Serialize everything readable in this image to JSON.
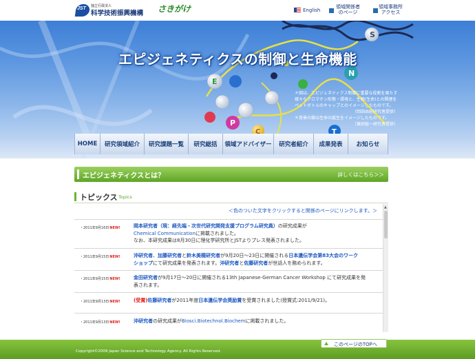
{
  "header": {
    "jst_small": "独立行政法人",
    "jst_name": "科学技術振興機構",
    "jst_mark": "JST",
    "sakigake": "さきがけ",
    "english": "English",
    "area_page": [
      "領域関係者",
      "のページ"
    ],
    "area_access": [
      "領域事務所",
      "アクセス"
    ]
  },
  "hero": {
    "title": "エピジェネティクスの制御と生命機能",
    "letters": [
      "S",
      "E",
      "N",
      "P",
      "C",
      "T"
    ],
    "caption": [
      "＊図は、エピジェネティクス制御に重要な役割を果たす様々なクロマチン形態・環境と、生物(生命)との関連をペットボトルのキャップとのイメージしたものです。",
      "（岡田由紀研究者提供）",
      "＊背景の鎖は生命の誕生をイメージしたものです。",
      "（東田裕一研究者提供）"
    ]
  },
  "nav": [
    "HOME",
    "研究領域紹介",
    "研究課題一覧",
    "研究総括",
    "領域アドバイザー",
    "研究者紹介",
    "成果発表",
    "お知らせ"
  ],
  "banner": {
    "title": "エピジェネティクスとは？",
    "link": "詳しくはこちら＞＞"
  },
  "topics": {
    "title": "トピックス",
    "subtitle": "Topics",
    "hint": "＜色のついた文字をクリックすると関係のページにリンクします。＞",
    "new_label": "NEW!",
    "items": [
      {
        "date": "・2011年9月16日",
        "l1a": "岡本研究者（現：経先端・次世代研究開発支援プログラム研究員）",
        "l1b": "の研究成果が",
        "l2": "Chemical Communication",
        "l2b": "に掲載されました。",
        "l3": "なお、本研究成果は8月30日に理化学研究所とJSTよりプレス発表されました。"
      },
      {
        "date": "・2011年9月15日",
        "a1": "沖研究者",
        "a2": "、",
        "a3": "加藤研究者",
        "a4": "と",
        "a5": "鈴木美穂研究者",
        "a6": "が9月20日〜23日に開催される",
        "a7": "日本遺伝学会第83大会のワーク",
        "b1": "ショップ",
        "b2": "にて研究成果を発表されます。",
        "b3": "沖研究者",
        "b4": "と",
        "b5": "佐藤研究者",
        "b6": "が世話人を務められます。"
      },
      {
        "date": "・2011年9月15日",
        "a1": "金田研究者",
        "a2": "が9月17日〜20日に開催される13th Japanese-German Cancer Workshop にて研究成果を発",
        "b1": "表されます。"
      },
      {
        "date": "・2011年9月13日",
        "a1": "(受賞)",
        "a2": "佐藤研究者",
        "a3": "が2011年度",
        "a4": "日本遺伝学会奨励賞",
        "a5": "を受賞されました(授賞式:2011/9/21)。"
      },
      {
        "date": "・2011年9月13日",
        "a1": "沖研究者",
        "a2": "の研究成果が",
        "a3": "Biosci.Biotechnol.Biochem",
        "a4": "に掲載されました。"
      }
    ]
  },
  "footer": {
    "copyright": "Copyright©2009 Japan Science and Technology Agency.  All Rights Reserved.",
    "page_top": "このページのTOPへ"
  },
  "colors": {
    "accent_green": "#6ab52f",
    "link_blue": "#1a56c0",
    "new_red": "#e0201a",
    "nav_text": "#1a3f7a"
  }
}
